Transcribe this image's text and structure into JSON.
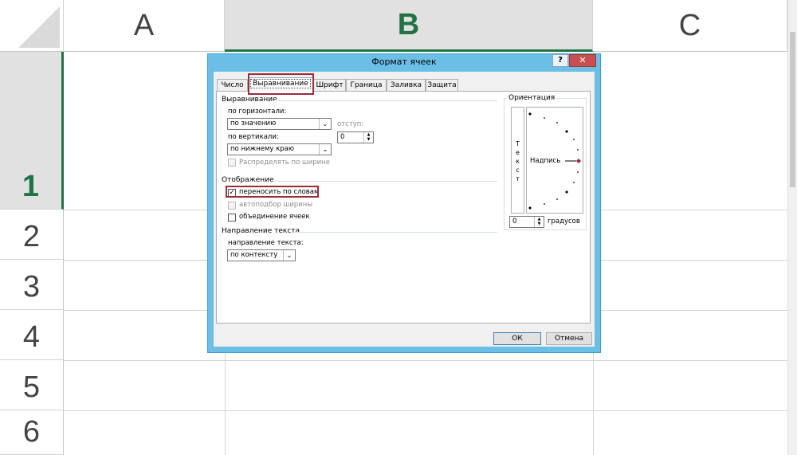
{
  "sheet": {
    "columns": [
      {
        "label": "A",
        "selected": false
      },
      {
        "label": "B",
        "selected": true
      },
      {
        "label": "C",
        "selected": false
      }
    ],
    "rows": [
      {
        "label": "1",
        "selected": true
      },
      {
        "label": "2",
        "selected": false
      },
      {
        "label": "3",
        "selected": false
      },
      {
        "label": "4",
        "selected": false
      },
      {
        "label": "5",
        "selected": false
      },
      {
        "label": "6",
        "selected": false
      }
    ],
    "accent_color": "#217346"
  },
  "dialog": {
    "title": "Формат ячеек",
    "help_label": "?",
    "close_label": "✕",
    "tabs": [
      "Число",
      "Выравнивание",
      "Шрифт",
      "Граница",
      "Заливка",
      "Защита"
    ],
    "active_tab": "Выравнивание",
    "highlight_color": "#9c2b3c",
    "alignment": {
      "section_title": "Выравнивание",
      "horizontal_label": "по горизонтали:",
      "horizontal_value": "по значению",
      "indent_label": "отступ:",
      "indent_value": "0",
      "vertical_label": "по вертикали:",
      "vertical_value": "по нижнему краю",
      "distribute_label": "Распределять по ширине",
      "distribute_checked": false
    },
    "display": {
      "section_title": "Отображение",
      "wrap_label": "переносить по словам",
      "wrap_checked": true,
      "shrink_label": "автоподбор ширины",
      "merge_label": "объединение ячеек"
    },
    "direction": {
      "section_title": "Направление текста",
      "label": "направление текста:",
      "value": "по контексту"
    },
    "orientation": {
      "title": "Ориентация",
      "vertical_text": [
        "Т",
        "е",
        "к",
        "с",
        "т"
      ],
      "dial_label": "Надпись",
      "degrees_value": "0",
      "degrees_label": "градусов"
    },
    "ok_label": "ОК",
    "cancel_label": "Отмена"
  }
}
